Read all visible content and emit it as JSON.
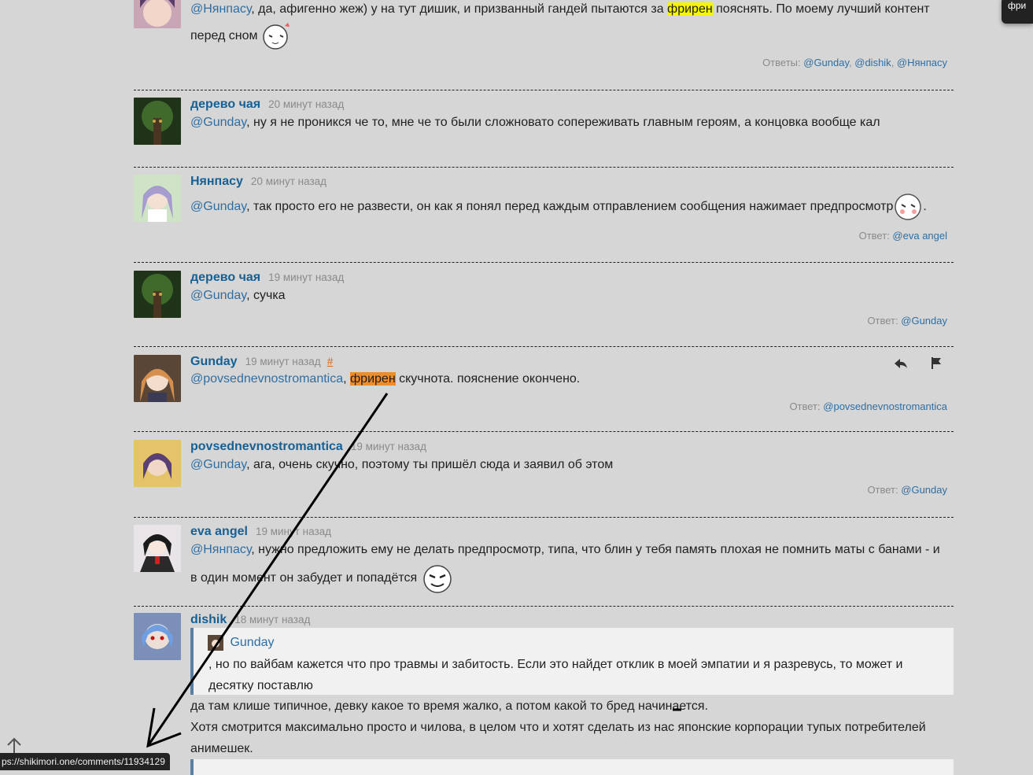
{
  "toast": {
    "text": "фри"
  },
  "comments": [
    {
      "body": {
        "mention": "@Нянпасу",
        "text1": ", да, афигенно жеж) у на тут дишик, и призванный гандей пытаются за ",
        "highlight": "фрирен",
        "text2": " пояснять. По моему лучший контент",
        "line2": "перед сном"
      },
      "replies": {
        "label": "Ответы:",
        "users": [
          "@Gunday",
          "@dishik",
          "@Нянпасу"
        ]
      }
    },
    {
      "author": "дерево чая",
      "time": "20 минут назад",
      "body": {
        "mention": "@Gunday",
        "text": ", ну я не проникся че то, мне че то были сложновато сопереживать главным героям, а концовка вообще кал"
      }
    },
    {
      "author": "Нянпасу",
      "time": "20 минут назад",
      "body": {
        "mention": "@Gunday",
        "text": ", так просто его не развести, он как я понял перед каждым отправлением сообщения нажимает предпросмотр",
        "tail": "."
      },
      "replies": {
        "label": "Ответ:",
        "users": [
          "@eva angel"
        ]
      }
    },
    {
      "author": "дерево чая",
      "time": "19 минут назад",
      "body": {
        "mention": "@Gunday",
        "text": ", сучка"
      },
      "replies": {
        "label": "Ответ:",
        "users": [
          "@Gunday"
        ]
      }
    },
    {
      "author": "Gunday",
      "time": "19 минут назад",
      "hash": "#",
      "body": {
        "mention": "@povsednevnostromantica",
        "sep": ", ",
        "highlight": "фрирен",
        "text": " скучнота. пояснение окончено."
      },
      "replies": {
        "label": "Ответ:",
        "users": [
          "@povsednevnostromantica"
        ]
      }
    },
    {
      "author": "povsednevnostromantica",
      "time": "19 минут назад",
      "body": {
        "mention": "@Gunday",
        "text": ", ага, очень скучно, поэтому ты пришёл сюда и заявил об этом"
      },
      "replies": {
        "label": "Ответ:",
        "users": [
          "@Gunday"
        ]
      }
    },
    {
      "author": "eva angel",
      "time": "19 минут назад",
      "body": {
        "mention": "@Нянпасу",
        "text": ", нужно предложить ему не делать предпросмотр, типа, что блин у тебя память плохая не помнить маты с банами - и",
        "line2": "в один момент он забудет и попадётся"
      }
    },
    {
      "author": "dishik",
      "time": "18 минут назад",
      "quote": {
        "author": "Gunday",
        "text1": ", но по вайбам кажется что про травмы и забитость. Если это найдет отклик в моей эмпатии и я разревусь, то может и",
        "text2": "десятку поставлю"
      },
      "body": {
        "line1": "да там клише типичное, девку какое то время жалко, а потом какой то бред начинается.",
        "line2": "Хотя смотрится максимально просто и чилова, в целом что и хотят сделать из нас японские корпорации тупых потребителей",
        "line3": "анимешек."
      }
    }
  ],
  "statusbar": {
    "url": "ps://shikimori.one/comments/11934129"
  },
  "colors": {
    "background": "#d6d6d6",
    "link": "#176093",
    "mention": "#2f6ea3",
    "highlight_yellow": "#f5f500",
    "highlight_orange": "#f08d2b"
  },
  "icons": [
    "reply-icon",
    "flag-icon",
    "scroll-up-icon",
    "sticker-icon"
  ]
}
